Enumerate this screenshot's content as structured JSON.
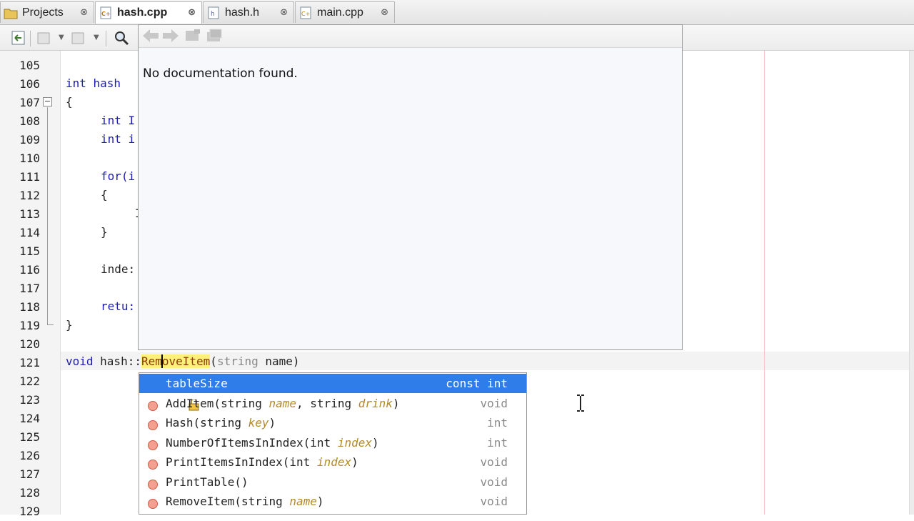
{
  "tabs": [
    {
      "label": "Projects",
      "active": false
    },
    {
      "label": "hash.cpp",
      "active": true
    },
    {
      "label": "hash.h",
      "active": false
    },
    {
      "label": "main.cpp",
      "active": false
    }
  ],
  "tab_close_glyph": "⊗",
  "icons": {
    "projects": "projects-folder-icon",
    "cpp_file": "cpp-file-icon",
    "h_file": "header-file-icon",
    "back": "back-arrow-icon",
    "forward": "forward-arrow-icon",
    "open_in_browser": "open-source-icon",
    "search": "search-icon",
    "method": "method-icon",
    "field": "field-icon"
  },
  "editor": {
    "line_numbers": [
      "105",
      "106",
      "107",
      "108",
      "109",
      "110",
      "111",
      "112",
      "113",
      "114",
      "115",
      "116",
      "117",
      "118",
      "119",
      "120",
      "121",
      "122",
      "123",
      "124",
      "125",
      "126",
      "127",
      "128",
      "129"
    ],
    "lines": {
      "l106": "int hash",
      "l107": "{",
      "l108": "int I",
      "l109": "int i",
      "l111": "for(i",
      "l112": "{",
      "l113": "I",
      "l114": "}",
      "l116": "inde:",
      "l118": "retu:",
      "l119": "}",
      "l121_kw": "void",
      "l121_class": " hash::",
      "l121_fn": "RemoveItem",
      "l121_paren_open": "(",
      "l121_type": "string",
      "l121_rest": " name)"
    }
  },
  "documentation": {
    "message": "No documentation found."
  },
  "completion": {
    "items": [
      {
        "name": "tableSize",
        "type": "const int",
        "selected": true,
        "kind": "field"
      },
      {
        "name": "AddItem(string ",
        "p1": "name",
        "mid": ", string ",
        "p2": "drink",
        "end": ")",
        "type": "void"
      },
      {
        "name": "Hash(string ",
        "p1": "key",
        "end": ")",
        "type": "int"
      },
      {
        "name": "NumberOfItemsInIndex(int ",
        "p1": "index",
        "end": ")",
        "type": "int"
      },
      {
        "name": "PrintItemsInIndex(int ",
        "p1": "index",
        "end": ")",
        "type": "void"
      },
      {
        "name": "PrintTable()",
        "type": "void"
      },
      {
        "name": "RemoveItem(string ",
        "p1": "name",
        "end": ")",
        "type": "void"
      }
    ]
  },
  "colors": {
    "selection": "#2f7de8",
    "keyword": "#1c1cb0",
    "param": "#b48a28",
    "method_icon": "#e8826e"
  }
}
